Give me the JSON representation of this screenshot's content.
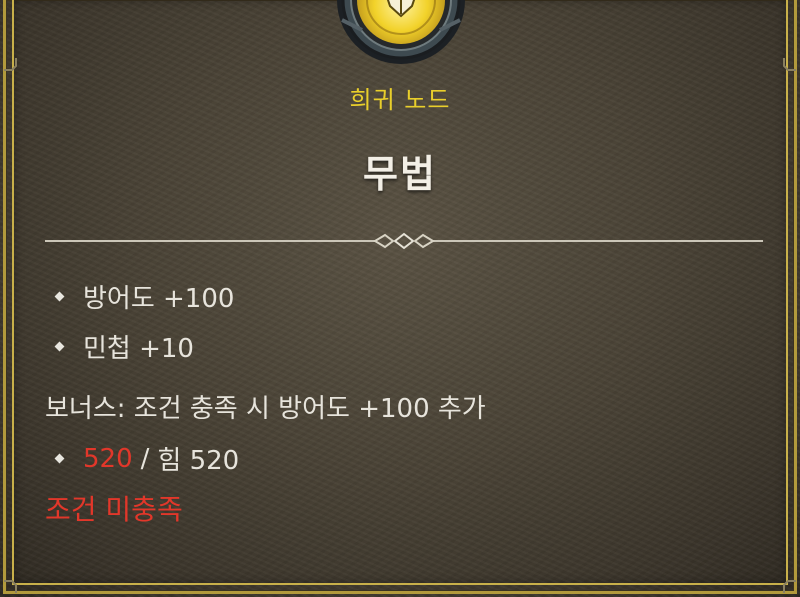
{
  "tooltip": {
    "rarity": "희귀 노드",
    "title": "무법",
    "stats": [
      {
        "text": "방어도 +100"
      },
      {
        "text": "민첩 +10"
      }
    ],
    "bonus": "보너스: 조건 충족 시 방어도 +100 추가",
    "requirement": {
      "current": "520",
      "separator": "/",
      "required": "힘 520"
    },
    "condition_status": "조건 미충족"
  },
  "colors": {
    "rarity": "#e9cf2b",
    "title": "#f3efe6",
    "text": "#e7e4dc",
    "unmet": "#e2372a",
    "frame": "#c8b04a"
  },
  "icons": {
    "emblem": "rare-node-emblem-icon",
    "bullet": "diamond-bullet-icon",
    "divider": "ornamental-divider"
  }
}
